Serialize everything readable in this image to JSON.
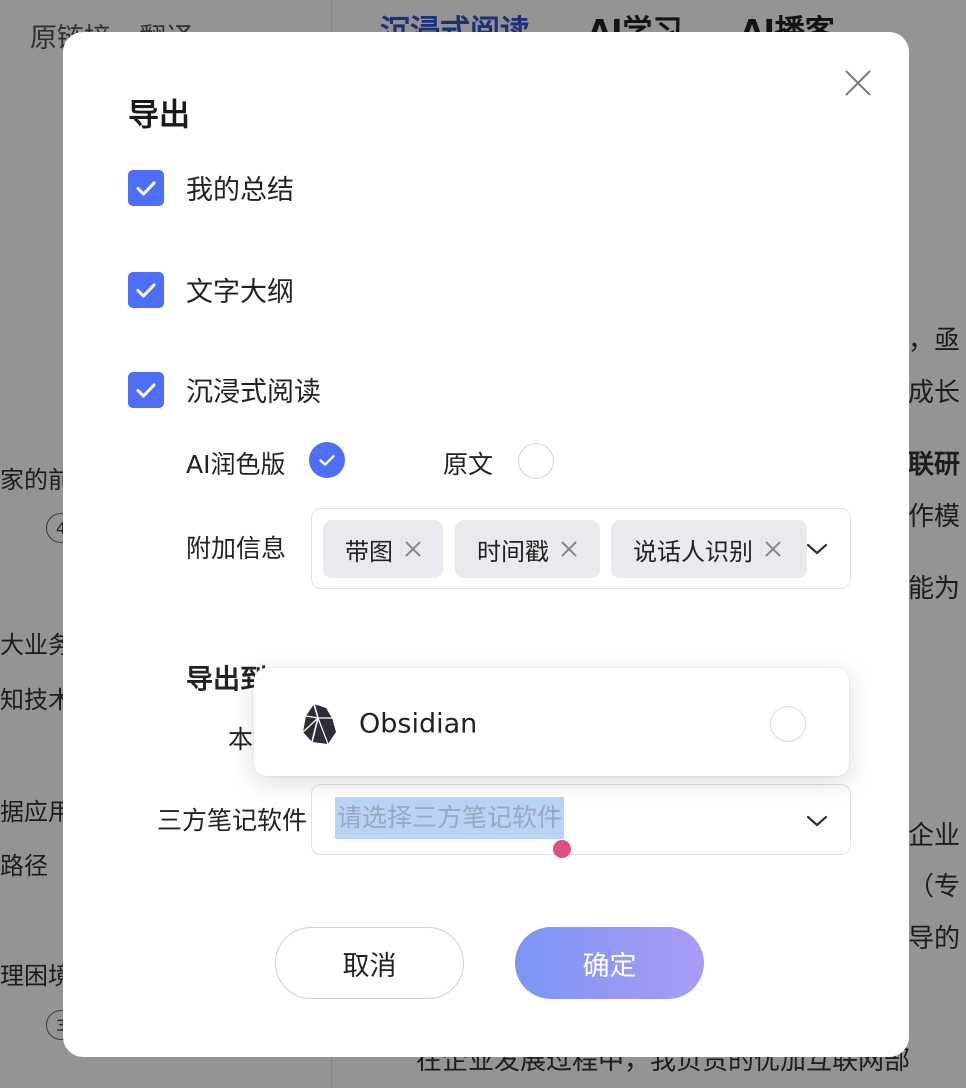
{
  "background": {
    "toolbar": [
      "原链接",
      "翻译"
    ],
    "tabs": [
      "沉浸式阅读",
      "AI学习",
      "AI播客"
    ],
    "left_fragments": [
      "家的前",
      "大业务",
      "知技术",
      "据应用",
      "路径",
      "理困境"
    ],
    "left_badges": [
      "4",
      "3"
    ],
    "right_fragments": [
      "，亟",
      "成长",
      "联研",
      "作模",
      "能为",
      "企业",
      "（专",
      "导的"
    ],
    "bottom_fragment": "在企业发展过程中，我负责的优加互联网部"
  },
  "modal": {
    "title": "导出",
    "checkboxes": [
      {
        "label": "我的总结",
        "checked": true
      },
      {
        "label": "文字大纲",
        "checked": true
      },
      {
        "label": "沉浸式阅读",
        "checked": true
      }
    ],
    "version_options": [
      {
        "label": "AI润色版",
        "selected": true
      },
      {
        "label": "原文",
        "selected": false
      }
    ],
    "extra_info_label": "附加信息",
    "extra_info_tags": [
      "带图",
      "时间戳",
      "说话人识别"
    ],
    "export_to_label": "导出到",
    "local_label": "本",
    "dropdown_options": [
      {
        "label": "Obsidian",
        "icon": "obsidian-icon",
        "selected": false
      }
    ],
    "notes_label": "三方笔记软件",
    "notes_placeholder": "请选择三方笔记软件",
    "cancel_label": "取消",
    "confirm_label": "确定"
  },
  "colors": {
    "accent": "#4f6ef7",
    "confirm_gradient_start": "#7b95f5",
    "confirm_gradient_end": "#a99cf3",
    "cursor": "#e04f7f"
  }
}
